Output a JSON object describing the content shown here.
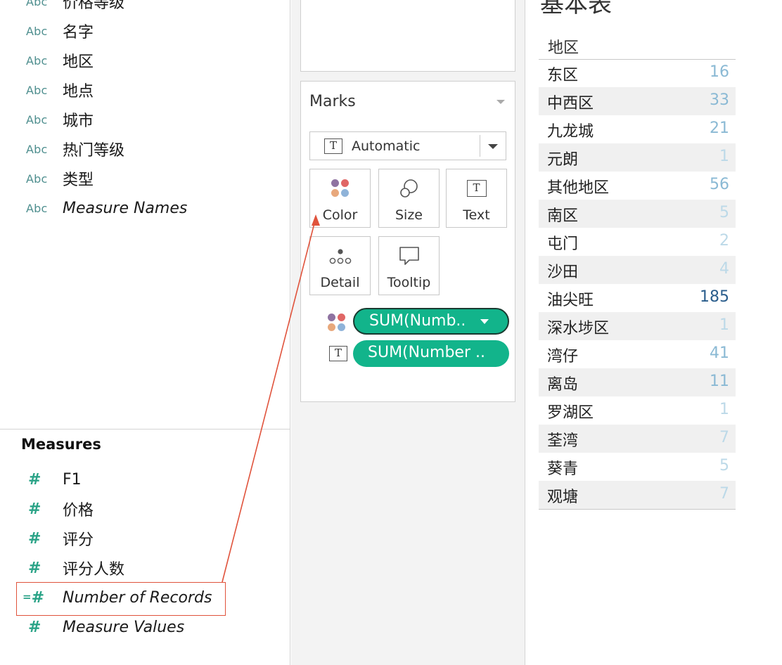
{
  "dimensions": {
    "fields": [
      {
        "type_label": "Abc",
        "name": "价格等级",
        "italic": false
      },
      {
        "type_label": "Abc",
        "name": "名字",
        "italic": false
      },
      {
        "type_label": "Abc",
        "name": "地区",
        "italic": false
      },
      {
        "type_label": "Abc",
        "name": "地点",
        "italic": false
      },
      {
        "type_label": "Abc",
        "name": "城市",
        "italic": false
      },
      {
        "type_label": "Abc",
        "name": "热门等级",
        "italic": false
      },
      {
        "type_label": "Abc",
        "name": "类型",
        "italic": false
      },
      {
        "type_label": "Abc",
        "name": "Measure Names",
        "italic": true
      }
    ]
  },
  "measures": {
    "title": "Measures",
    "fields": [
      {
        "name": "F1",
        "italic": false,
        "calculated": false
      },
      {
        "name": "价格",
        "italic": false,
        "calculated": false
      },
      {
        "name": "评分",
        "italic": false,
        "calculated": false
      },
      {
        "name": "评分人数",
        "italic": false,
        "calculated": false
      },
      {
        "name": "Number of Records",
        "italic": true,
        "calculated": true,
        "highlighted": true
      },
      {
        "name": "Measure Values",
        "italic": true,
        "calculated": false
      }
    ]
  },
  "marks": {
    "title": "Marks",
    "mark_type": "Automatic",
    "mark_type_icon": "T",
    "buttons": {
      "color": "Color",
      "size": "Size",
      "text": "Text",
      "detail": "Detail",
      "tooltip": "Tooltip"
    },
    "text_icon": "T",
    "pills": [
      {
        "icon": "color-dots-icon",
        "label": "SUM(Numb..",
        "selected": true
      },
      {
        "icon": "text-icon",
        "icon_label": "T",
        "label": "SUM(Number .."
      }
    ],
    "color_dots": [
      "#8f73a1",
      "#e06766",
      "#e8a87c",
      "#8fb3d9"
    ]
  },
  "viz": {
    "sheet_title": "基本表",
    "column_header": "地区",
    "color_scale": {
      "light": "#bcd9e8",
      "mid": "#8ab9d4",
      "dark": "#2a5d8c"
    },
    "rows": [
      {
        "region": "东区",
        "value": 16
      },
      {
        "region": "中西区",
        "value": 33
      },
      {
        "region": "九龙城",
        "value": 21
      },
      {
        "region": "元朗",
        "value": 1
      },
      {
        "region": "其他地区",
        "value": 56
      },
      {
        "region": "南区",
        "value": 5
      },
      {
        "region": "屯门",
        "value": 2
      },
      {
        "region": "沙田",
        "value": 4
      },
      {
        "region": "油尖旺",
        "value": 185
      },
      {
        "region": "深水埗区",
        "value": 1
      },
      {
        "region": "湾仔",
        "value": 41
      },
      {
        "region": "离岛",
        "value": 11
      },
      {
        "region": "罗湖区",
        "value": 1
      },
      {
        "region": "荃湾",
        "value": 7
      },
      {
        "region": "葵青",
        "value": 5
      },
      {
        "region": "观塘",
        "value": 7
      }
    ]
  },
  "annotation": {
    "arrow_color": "#e0533c"
  }
}
